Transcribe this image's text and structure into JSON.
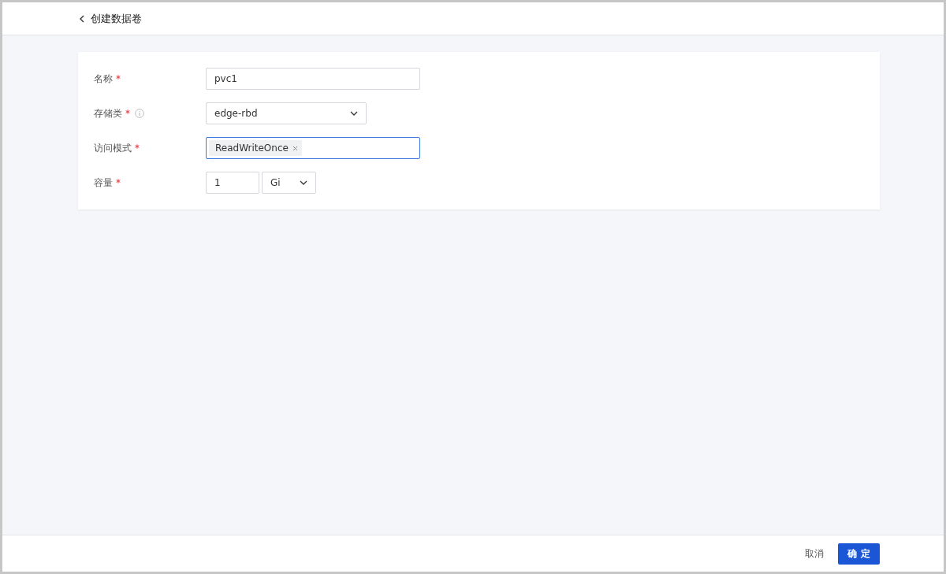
{
  "header": {
    "title": "创建数据卷"
  },
  "fields": [
    {
      "kind": "text",
      "label": "名称",
      "required": true,
      "info": false,
      "value": "pvc1",
      "focused": false
    },
    {
      "kind": "select",
      "label": "存储类",
      "required": true,
      "info": true,
      "value": "edge-rbd",
      "focused": false
    },
    {
      "kind": "tags",
      "label": "访问模式",
      "required": true,
      "info": false,
      "tags": [
        "ReadWriteOnce"
      ],
      "focused": true
    },
    {
      "kind": "quantity",
      "label": "容量",
      "required": true,
      "info": false,
      "value": "1",
      "unit": "Gi",
      "focused": false
    }
  ],
  "footer": {
    "cancel": "取消",
    "confirm": "确 定"
  }
}
